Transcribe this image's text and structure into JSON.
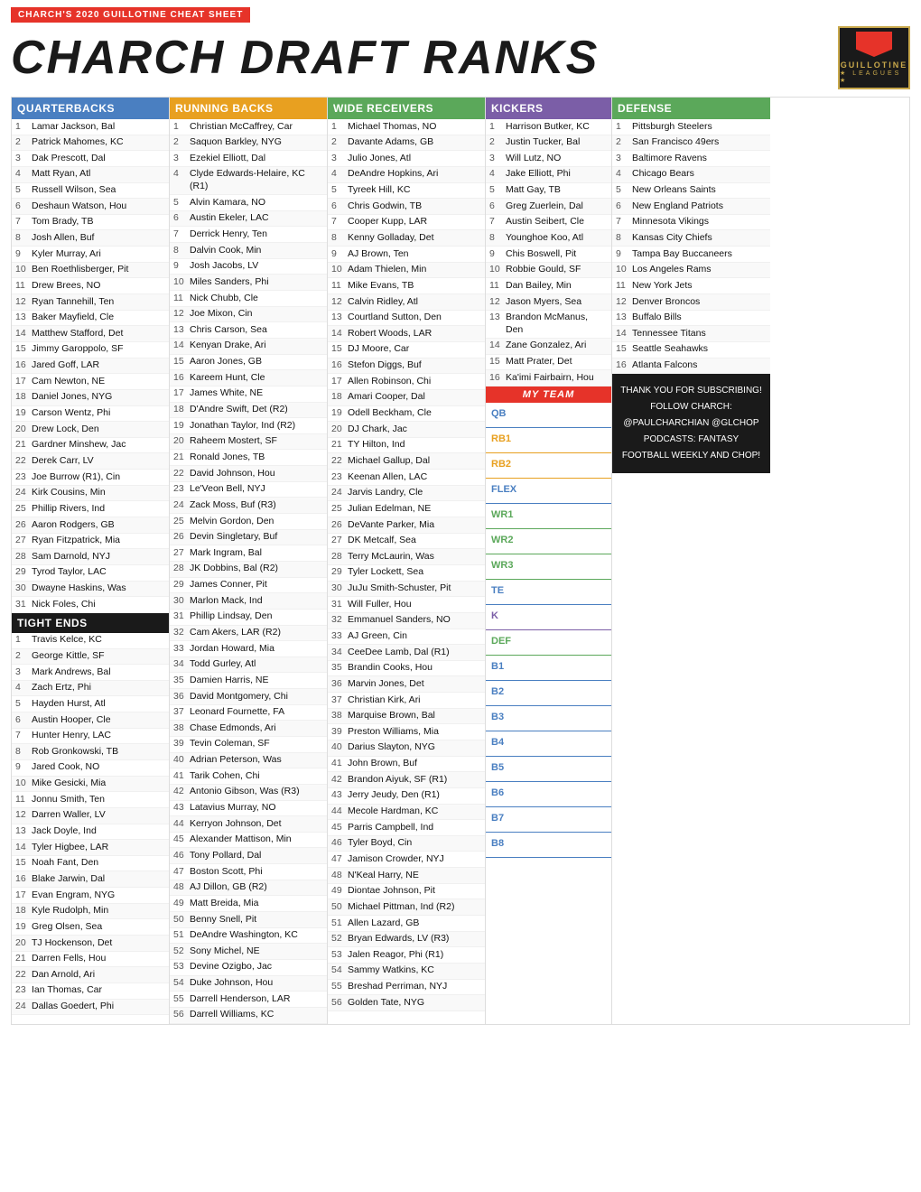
{
  "header": {
    "top_bar": "CHARCH'S 2020 GUILLOTINE CHEAT SHEET",
    "title": "CHARCH DRAFT RANKS"
  },
  "columns": {
    "qb": {
      "label": "QUARTERBACKS",
      "players": [
        "Lamar Jackson, Bal",
        "Patrick Mahomes, KC",
        "Dak Prescott, Dal",
        "Matt Ryan, Atl",
        "Russell Wilson, Sea",
        "Deshaun Watson, Hou",
        "Tom Brady, TB",
        "Josh Allen, Buf",
        "Kyler Murray, Ari",
        "Ben Roethlisberger, Pit",
        "Drew Brees, NO",
        "Ryan Tannehill, Ten",
        "Baker Mayfield, Cle",
        "Matthew Stafford, Det",
        "Jimmy Garoppolo, SF",
        "Jared Goff, LAR",
        "Cam Newton, NE",
        "Daniel Jones, NYG",
        "Carson Wentz, Phi",
        "Drew Lock, Den",
        "Gardner Minshew, Jac",
        "Derek Carr, LV",
        "Joe Burrow (R1), Cin",
        "Kirk Cousins, Min",
        "Phillip Rivers, Ind",
        "Aaron Rodgers, GB",
        "Ryan Fitzpatrick, Mia",
        "Sam Darnold, NYJ",
        "Tyrod Taylor, LAC",
        "Dwayne Haskins, Was",
        "Nick Foles, Chi"
      ]
    },
    "rb": {
      "label": "RUNNING BACKS",
      "players": [
        "Christian McCaffrey, Car",
        "Saquon Barkley, NYG",
        "Ezekiel Elliott, Dal",
        "Clyde Edwards-Helaire, KC (R1)",
        "Alvin Kamara, NO",
        "Austin Ekeler, LAC",
        "Derrick Henry, Ten",
        "Dalvin Cook, Min",
        "Josh Jacobs, LV",
        "Miles Sanders, Phi",
        "Nick Chubb, Cle",
        "Joe Mixon, Cin",
        "Chris Carson, Sea",
        "Kenyan Drake, Ari",
        "Aaron Jones, GB",
        "Kareem Hunt, Cle",
        "James White, NE",
        "D'Andre Swift, Det (R2)",
        "Jonathan Taylor, Ind (R2)",
        "Raheem Mostert, SF",
        "Ronald Jones, TB",
        "David Johnson, Hou",
        "Le'Veon Bell, NYJ",
        "Zack Moss, Buf (R3)",
        "Melvin Gordon, Den",
        "Devin Singletary, Buf",
        "Mark Ingram, Bal",
        "JK Dobbins, Bal (R2)",
        "James Conner, Pit",
        "Marlon Mack, Ind",
        "Phillip Lindsay, Den",
        "Cam Akers, LAR (R2)",
        "Jordan Howard, Mia",
        "Todd Gurley, Atl",
        "Damien Harris, NE",
        "David Montgomery, Chi",
        "Leonard Fournette, FA",
        "Chase Edmonds, Ari",
        "Tevin Coleman, SF",
        "Adrian Peterson, Was",
        "Tarik Cohen, Chi",
        "Antonio Gibson, Was (R3)",
        "Latavius Murray, NO",
        "Kerryon Johnson, Det",
        "Alexander Mattison, Min",
        "Tony Pollard, Dal",
        "Boston Scott, Phi",
        "AJ Dillon, GB (R2)",
        "Matt Breida, Mia",
        "Benny Snell, Pit",
        "DeAndre Washington, KC",
        "Sony Michel, NE",
        "Devine Ozigbo, Jac",
        "Duke Johnson, Hou",
        "Darrell Henderson, LAR",
        "Darrell Williams, KC"
      ]
    },
    "wr": {
      "label": "WIDE RECEIVERS",
      "players": [
        "Michael Thomas, NO",
        "Davante Adams, GB",
        "Julio Jones, Atl",
        "DeAndre Hopkins, Ari",
        "Tyreek Hill, KC",
        "Chris Godwin, TB",
        "Cooper Kupp, LAR",
        "Kenny Golladay, Det",
        "AJ Brown, Ten",
        "Adam Thielen, Min",
        "Mike Evans, TB",
        "Calvin Ridley, Atl",
        "Courtland Sutton, Den",
        "Robert Woods, LAR",
        "DJ Moore, Car",
        "Stefon Diggs, Buf",
        "Allen Robinson, Chi",
        "Amari Cooper, Dal",
        "Odell Beckham, Cle",
        "DJ Chark, Jac",
        "TY Hilton, Ind",
        "Michael Gallup, Dal",
        "Keenan Allen, LAC",
        "Jarvis Landry, Cle",
        "Julian Edelman, NE",
        "DeVante Parker, Mia",
        "DK Metcalf, Sea",
        "Terry McLaurin, Was",
        "Tyler Lockett, Sea",
        "JuJu Smith-Schuster, Pit",
        "Will Fuller, Hou",
        "Emmanuel Sanders, NO",
        "AJ Green, Cin",
        "CeeDee Lamb, Dal (R1)",
        "Brandin Cooks, Hou",
        "Marvin Jones, Det",
        "Christian Kirk, Ari",
        "Marquise Brown, Bal",
        "Preston Williams, Mia",
        "Darius Slayton, NYG",
        "John Brown, Buf",
        "Brandon Aiyuk, SF (R1)",
        "Jerry Jeudy, Den (R1)",
        "Mecole Hardman, KC",
        "Parris Campbell, Ind",
        "Tyler Boyd, Cin",
        "Jamison Crowder, NYJ",
        "N'Keal Harry, NE",
        "Diontae Johnson, Pit",
        "Michael Pittman, Ind (R2)",
        "Allen Lazard, GB",
        "Bryan Edwards, LV (R3)",
        "Jalen Reagor, Phi (R1)",
        "Sammy Watkins, KC",
        "Breshad Perriman, NYJ",
        "Golden Tate, NYG"
      ]
    },
    "k": {
      "label": "KICKERS",
      "players": [
        "Harrison Butker, KC",
        "Justin Tucker, Bal",
        "Will Lutz, NO",
        "Jake Elliott, Phi",
        "Matt Gay, TB",
        "Greg Zuerlein, Dal",
        "Austin Seibert, Cle",
        "Younghoe Koo, Atl",
        "Chis Boswell, Pit",
        "Robbie Gould, SF",
        "Dan Bailey, Min",
        "Jason Myers, Sea",
        "Brandon McManus, Den",
        "Zane Gonzalez, Ari",
        "Matt Prater, Det",
        "Ka'imi Fairbairn, Hou"
      ]
    },
    "def": {
      "label": "DEFENSE",
      "players": [
        "Pittsburgh Steelers",
        "San Francisco 49ers",
        "Baltimore Ravens",
        "Chicago Bears",
        "New Orleans Saints",
        "New England Patriots",
        "Minnesota Vikings",
        "Kansas City Chiefs",
        "Tampa Bay Buccaneers",
        "Los Angeles Rams",
        "New York Jets",
        "Denver Broncos",
        "Buffalo Bills",
        "Tennessee Titans",
        "Seattle Seahawks",
        "Atlanta Falcons"
      ]
    },
    "te": {
      "label": "TIGHT ENDS",
      "players": [
        "Travis Kelce, KC",
        "George Kittle, SF",
        "Mark Andrews, Bal",
        "Zach Ertz, Phi",
        "Hayden Hurst, Atl",
        "Austin Hooper, Cle",
        "Hunter Henry, LAC",
        "Rob Gronkowski, TB",
        "Jared Cook, NO",
        "Mike Gesicki, Mia",
        "Jonnu Smith, Ten",
        "Darren Waller, LV",
        "Jack Doyle, Ind",
        "Tyler Higbee, LAR",
        "Noah Fant, Den",
        "Blake Jarwin, Dal",
        "Evan Engram, NYG",
        "Kyle Rudolph, Min",
        "Greg Olsen, Sea",
        "TJ Hockenson, Det",
        "Darren Fells, Hou",
        "Dan Arnold, Ari",
        "Ian Thomas, Car",
        "Dallas Goedert, Phi"
      ]
    }
  },
  "myteam": {
    "label": "MY TEAM",
    "slots": [
      {
        "label": "QB",
        "color": "blue"
      },
      {
        "label": "RB1",
        "color": "orange"
      },
      {
        "label": "RB2",
        "color": "orange"
      },
      {
        "label": "FLEX",
        "color": "blue"
      },
      {
        "label": "WR1",
        "color": "green"
      },
      {
        "label": "WR2",
        "color": "green"
      },
      {
        "label": "WR3",
        "color": "green"
      },
      {
        "label": "TE",
        "color": "blue"
      },
      {
        "label": "K",
        "color": "purple"
      },
      {
        "label": "DEF",
        "color": "green"
      },
      {
        "label": "B1",
        "color": "blue"
      },
      {
        "label": "B2",
        "color": "blue"
      },
      {
        "label": "B3",
        "color": "blue"
      },
      {
        "label": "B4",
        "color": "blue"
      },
      {
        "label": "B5",
        "color": "blue"
      },
      {
        "label": "B6",
        "color": "blue"
      },
      {
        "label": "B7",
        "color": "blue"
      },
      {
        "label": "B8",
        "color": "blue"
      }
    ]
  },
  "thankyou": {
    "line1": "THANK YOU FOR SUBSCRIBING!",
    "line2": "FOLLOW CHARCH: @PAULCHARCHIAN @GLCHOP",
    "line3": "PODCASTS: FANTASY FOOTBALL WEEKLY AND CHOP!"
  }
}
